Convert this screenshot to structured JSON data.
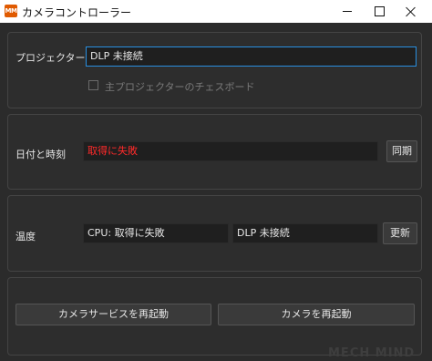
{
  "window": {
    "logo_text": "MM",
    "title": "カメラコントローラー"
  },
  "projector": {
    "label": "プロジェクター",
    "value": "DLP 未接続",
    "checkbox_label": "主プロジェクターのチェスボード",
    "checkbox_checked": false
  },
  "datetime": {
    "label": "日付と時刻",
    "value": "取得に失敗",
    "sync_button": "同期"
  },
  "temperature": {
    "label": "温度",
    "cpu_value": "CPU: 取得に失敗",
    "dlp_value": "DLP 未接続",
    "refresh_button": "更新"
  },
  "actions": {
    "restart_camera_service": "カメラサービスを再起動",
    "restart_camera": "カメラを再起動"
  },
  "watermark": "MECH MIND",
  "colors": {
    "background": "#2b2b2b",
    "focus_border": "#2a8fe0",
    "error_text": "#ff2a2a"
  }
}
